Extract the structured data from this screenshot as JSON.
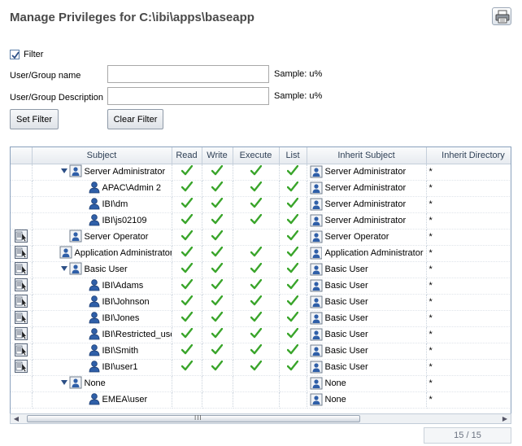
{
  "title": "Manage Privileges for C:\\ibi\\apps\\baseapp",
  "filter": {
    "checkbox_label": "Filter",
    "checked": true,
    "name_label": "User/Group name",
    "name_value": "",
    "name_sample": "Sample: u%",
    "desc_label": "User/Group Description",
    "desc_value": "",
    "desc_sample": "Sample: u%",
    "set_button": "Set Filter",
    "clear_button": "Clear Filter"
  },
  "grid": {
    "columns": [
      "",
      "Subject",
      "Read",
      "Write",
      "Execute",
      "List",
      "Inherit Subject",
      "Inherit Directory"
    ],
    "rows": [
      {
        "edit": false,
        "toggle": "expanded",
        "type": "group",
        "depth": 0,
        "subject": "Server Administrator",
        "read": true,
        "write": true,
        "execute": true,
        "list": true,
        "inherit_type": "group",
        "inherit_subject": "Server Administrator",
        "inherit_dir": "*"
      },
      {
        "edit": false,
        "toggle": "",
        "type": "user",
        "depth": 1,
        "subject": "APAC\\Admin 2",
        "read": true,
        "write": true,
        "execute": true,
        "list": true,
        "inherit_type": "group",
        "inherit_subject": "Server Administrator",
        "inherit_dir": "*"
      },
      {
        "edit": false,
        "toggle": "",
        "type": "user",
        "depth": 1,
        "subject": "IBI\\dm",
        "read": true,
        "write": true,
        "execute": true,
        "list": true,
        "inherit_type": "group",
        "inherit_subject": "Server Administrator",
        "inherit_dir": "*"
      },
      {
        "edit": false,
        "toggle": "",
        "type": "user",
        "depth": 1,
        "subject": "IBI\\js02109",
        "read": true,
        "write": true,
        "execute": true,
        "list": true,
        "inherit_type": "group",
        "inherit_subject": "Server Administrator",
        "inherit_dir": "*"
      },
      {
        "edit": true,
        "toggle": "",
        "type": "group",
        "depth": 0,
        "subject": "Server Operator",
        "read": true,
        "write": true,
        "execute": false,
        "list": true,
        "inherit_type": "group",
        "inherit_subject": "Server Operator",
        "inherit_dir": "*"
      },
      {
        "edit": true,
        "toggle": "",
        "type": "group",
        "depth": 0,
        "subject": "Application Administrator",
        "read": true,
        "write": true,
        "execute": true,
        "list": true,
        "inherit_type": "group",
        "inherit_subject": "Application Administrator",
        "inherit_dir": "*"
      },
      {
        "edit": true,
        "toggle": "expanded",
        "type": "group",
        "depth": 0,
        "subject": "Basic User",
        "read": true,
        "write": true,
        "execute": true,
        "list": true,
        "inherit_type": "group",
        "inherit_subject": "Basic User",
        "inherit_dir": "*"
      },
      {
        "edit": true,
        "toggle": "",
        "type": "user",
        "depth": 1,
        "subject": "IBI\\Adams",
        "read": true,
        "write": true,
        "execute": true,
        "list": true,
        "inherit_type": "group",
        "inherit_subject": "Basic User",
        "inherit_dir": "*"
      },
      {
        "edit": true,
        "toggle": "",
        "type": "user",
        "depth": 1,
        "subject": "IBI\\Johnson",
        "read": true,
        "write": true,
        "execute": true,
        "list": true,
        "inherit_type": "group",
        "inherit_subject": "Basic User",
        "inherit_dir": "*"
      },
      {
        "edit": true,
        "toggle": "",
        "type": "user",
        "depth": 1,
        "subject": "IBI\\Jones",
        "read": true,
        "write": true,
        "execute": true,
        "list": true,
        "inherit_type": "group",
        "inherit_subject": "Basic User",
        "inherit_dir": "*"
      },
      {
        "edit": true,
        "toggle": "",
        "type": "user",
        "depth": 1,
        "subject": "IBI\\Restricted_user",
        "read": true,
        "write": true,
        "execute": true,
        "list": true,
        "inherit_type": "group",
        "inherit_subject": "Basic User",
        "inherit_dir": "*"
      },
      {
        "edit": true,
        "toggle": "",
        "type": "user",
        "depth": 1,
        "subject": "IBI\\Smith",
        "read": true,
        "write": true,
        "execute": true,
        "list": true,
        "inherit_type": "group",
        "inherit_subject": "Basic User",
        "inherit_dir": "*"
      },
      {
        "edit": true,
        "toggle": "",
        "type": "user",
        "depth": 1,
        "subject": "IBI\\user1",
        "read": true,
        "write": true,
        "execute": true,
        "list": true,
        "inherit_type": "group",
        "inherit_subject": "Basic User",
        "inherit_dir": "*"
      },
      {
        "edit": false,
        "toggle": "expanded",
        "type": "group",
        "depth": 0,
        "subject": "None",
        "read": false,
        "write": false,
        "execute": false,
        "list": false,
        "inherit_type": "group",
        "inherit_subject": "None",
        "inherit_dir": "*"
      },
      {
        "edit": false,
        "toggle": "",
        "type": "user",
        "depth": 1,
        "subject": "EMEA\\user",
        "read": false,
        "write": false,
        "execute": false,
        "list": false,
        "inherit_type": "group",
        "inherit_subject": "None",
        "inherit_dir": "*"
      }
    ]
  },
  "scrollbar": {
    "grip": "III"
  },
  "pager": {
    "text": "15 / 15"
  },
  "colors": {
    "check": "#3aa52b",
    "accent": "#2c4f86",
    "title": "#4a4a4a"
  },
  "icons": {
    "print": "print-icon",
    "group": "group-icon",
    "user": "user-icon",
    "edit": "edit-privileges-icon",
    "check": "check-icon",
    "expand": "expand-triangle-icon"
  }
}
